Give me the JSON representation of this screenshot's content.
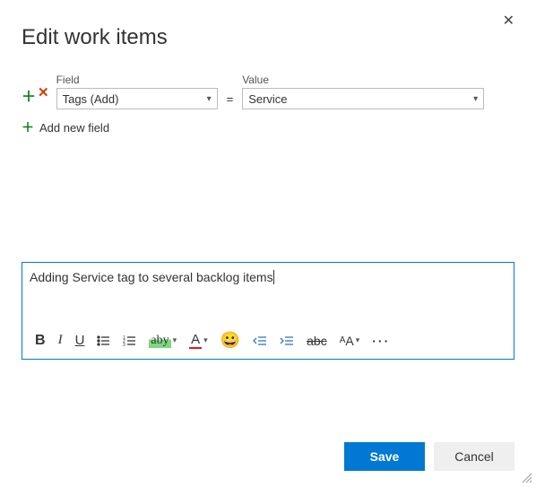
{
  "dialog": {
    "title": "Edit work items",
    "fieldLabel": "Field",
    "valueLabel": "Value",
    "fieldSelected": "Tags (Add)",
    "valueSelected": "Service",
    "eq": "=",
    "addNewField": "Add new field",
    "note": "Adding Service tag to several backlog items"
  },
  "toolbar": {
    "bold": "B",
    "italic": "I",
    "underline": "U",
    "highlightSample": "aby",
    "colorSample": "A",
    "emoji": "😀",
    "strike": "abc",
    "fontSizeBig": "A",
    "fontSizeSmall": "A",
    "more": "···"
  },
  "footer": {
    "save": "Save",
    "cancel": "Cancel"
  }
}
